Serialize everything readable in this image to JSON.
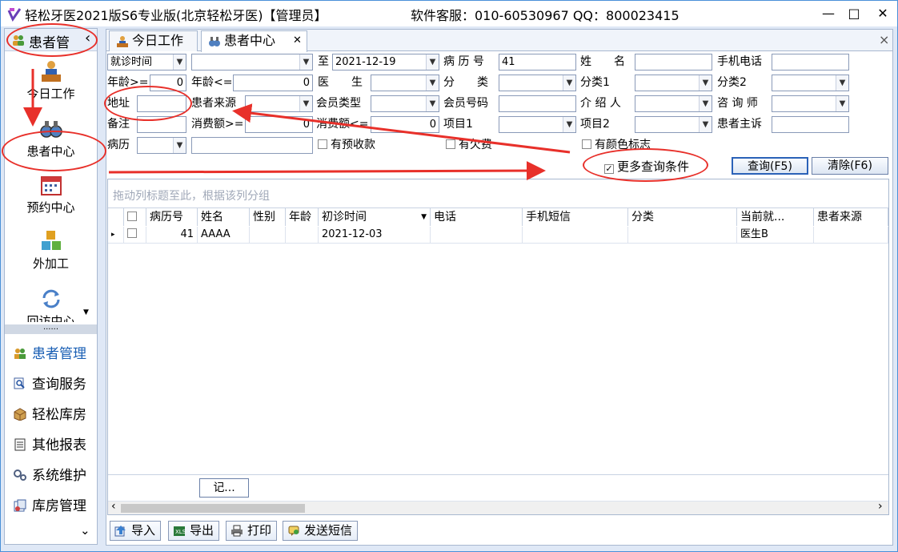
{
  "window": {
    "title": "轻松牙医2021版S6专业版(北京轻松牙医)【管理员】",
    "service": "软件客服：010-60530967 QQ：800023415",
    "minimize": "—",
    "maximize": "□",
    "close": "✕"
  },
  "nav": {
    "header": "患者管",
    "collapse_icon": "‹",
    "tiles": [
      {
        "label": "今日工作"
      },
      {
        "label": "患者中心"
      },
      {
        "label": "预约中心"
      },
      {
        "label": "外加工"
      },
      {
        "label": "回访中心"
      }
    ],
    "grip": "......",
    "list": [
      {
        "label": "患者管理"
      },
      {
        "label": "查询服务"
      },
      {
        "label": "轻松库房"
      },
      {
        "label": "其他报表"
      },
      {
        "label": "系统维护"
      },
      {
        "label": "库房管理"
      }
    ],
    "more": "⌄"
  },
  "tabs": [
    {
      "label": "今日工作"
    },
    {
      "label": "患者中心",
      "close": "✕"
    }
  ],
  "tabbar_close": "×",
  "filters": {
    "date_type": "就诊时间",
    "to_label": "至",
    "to_date": "2021-12-19",
    "record_no_label": "病 历 号",
    "record_no": "41",
    "name_label": "姓　　名",
    "mobile_label": "手机电话",
    "age_ge_label": "年龄>=",
    "age_ge": "0",
    "age_le_label": "年龄<=",
    "age_le": "0",
    "doctor_label": "医　　生",
    "category_label": "分　　类",
    "category1_label": "分类1",
    "category2_label": "分类2",
    "address_label": "地址",
    "source_label": "患者来源",
    "member_type_label": "会员类型",
    "member_no_label": "会员号码",
    "referrer_label": "介 绍 人",
    "consultant_label": "咨 询 师",
    "note_label": "备注",
    "spend_ge_label": "消费额>=",
    "spend_ge": "0",
    "spend_le_label": "消费额<=",
    "spend_le": "0",
    "item1_label": "项目1",
    "item2_label": "项目2",
    "complaint_label": "患者主诉",
    "record_label": "病历",
    "prepaid_label": "有预收款",
    "owed_label": "有欠费",
    "color_label": "有颜色标志",
    "more_conditions_label": "更多查询条件",
    "more_conditions_checked": "✓",
    "query_button": "查询(F5)",
    "clear_button": "清除(F6)"
  },
  "grid": {
    "group_hint": "拖动列标题至此，根据该列分组",
    "columns": [
      "病历号",
      "姓名",
      "性别",
      "年龄",
      "初诊时间",
      "电话",
      "手机短信",
      "分类",
      "当前就...",
      "患者来源"
    ],
    "rows": [
      {
        "indicator": "▸",
        "record_no": "41",
        "name": "AAAA",
        "gender": "",
        "age": "",
        "first_visit": "2021-12-03",
        "phone": "",
        "sms": "",
        "category": "",
        "current_doctor": "医生B",
        "source": ""
      }
    ],
    "footer_count": "记...",
    "sort_arrow": "▼",
    "scroll_left": "‹",
    "scroll_right": "›"
  },
  "toolbar": {
    "import": "导入",
    "export": "导出",
    "print": "打印",
    "sms": "发送短信"
  },
  "colors": {
    "frame": "#4a90d9",
    "nav_list_text": "#1a5fb4",
    "annotation": "#e8302a"
  }
}
